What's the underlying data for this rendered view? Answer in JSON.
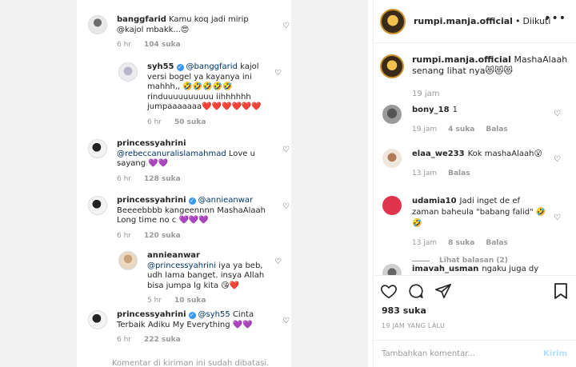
{
  "left_panel": {
    "comments": [
      {
        "username": "banggfarid",
        "verified": false,
        "mention": "",
        "text": "Kamu koq jadi mirip @kajol mbakk...😍",
        "time": "6 hr",
        "likes": "104 suka"
      },
      {
        "username": "syh55",
        "verified": true,
        "mention": "@banggfarid",
        "text": "kajol versi bogel ya kayanya ini mahhh,, 🤣🤣🤣🤣🤣 rinduuuuuuuuuu iihhhhhh jumpaaaaaaa❤️❤️❤️❤️❤️❤️",
        "time": "6 hr",
        "likes": "50 suka"
      },
      {
        "username": "princessyahrini",
        "verified": false,
        "mention": "@rebeccanuralislamahmad",
        "text": "Love u sayang 💜💜",
        "time": "6 hr",
        "likes": "128 suka"
      },
      {
        "username": "princessyahrini",
        "verified": true,
        "mention": "@annieanwar",
        "text": "Beeeebbbb kangeennnn MashaAlaah Long time no c 💜💜💜",
        "time": "6 hr",
        "likes": "120 suka"
      },
      {
        "username": "annieanwar",
        "verified": false,
        "mention": "@princessyahrini",
        "text": "iya ya beb, udh lama banget. insya Allah bisa jumpa lg kita 😘❤️",
        "time": "5 hr",
        "likes": "10 suka"
      },
      {
        "username": "princessyahrini",
        "verified": true,
        "mention": "@syh55",
        "text": "Cinta Terbaik Adiku My Everything 💜💜",
        "time": "6 hr",
        "likes": "222 suka"
      }
    ],
    "footer": "Komentar di kiriman ini sudah dibatasi."
  },
  "right_panel": {
    "header": {
      "username": "rumpi.manja.official",
      "separator": "•",
      "follow_status": "Diikuti"
    },
    "caption": {
      "username": "rumpi.manja.official",
      "text": "MashaAlaah senang lihat nya😻😻😻",
      "time": "19 jam"
    },
    "comments": [
      {
        "username": "bony_18",
        "text": "1",
        "time": "19 jam",
        "likes": "4 suka",
        "reply": "Balas",
        "view_replies": ""
      },
      {
        "username": "elaa_we233",
        "text": "Kok mashaAlaah😮",
        "time": "13 jam",
        "likes": "",
        "reply": "Balas",
        "view_replies": ""
      },
      {
        "username": "udamia10",
        "text": "Jadi inget de ef zaman baheula \"babang falid\" 🤣🤣",
        "time": "13 jam",
        "likes": "8 suka",
        "reply": "Balas",
        "view_replies": "Lihat balasan (2)"
      }
    ],
    "cut_comment": {
      "username": "imavah_usman",
      "text": "ngaku juga dy"
    },
    "likes_count": "983 suka",
    "date": "19 JAM YANG LALU",
    "comment_input": {
      "placeholder": "Tambahkan komentar...",
      "post_label": "Kirim"
    }
  },
  "icons": {
    "heart": "heart-icon",
    "comment": "comment-bubble-icon",
    "share": "paper-plane-icon",
    "save": "bookmark-icon",
    "more": "more-dots-icon"
  }
}
